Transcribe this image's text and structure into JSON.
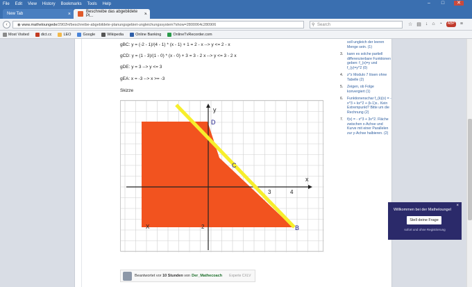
{
  "menu": [
    "File",
    "Edit",
    "View",
    "History",
    "Bookmarks",
    "Tools",
    "Help"
  ],
  "tabs": [
    {
      "label": "New Tab"
    },
    {
      "label": "Beschreibe das abgebildete Pl..."
    }
  ],
  "nav": {
    "url_host": "www.matheloungede",
    "url_path": "/2902H/beschreibe-abgebildete-planungsgebiet-ungleichungssystem?show=2800064c280906",
    "search_placeholder": "Search"
  },
  "bookmarks": [
    {
      "label": "Most Visited",
      "color": "#8a8a8a"
    },
    {
      "label": "dict.cc",
      "color": "#c23b22"
    },
    {
      "label": "LEO",
      "color": "#f2b84b"
    },
    {
      "label": "Google",
      "color": "#4a84d8"
    },
    {
      "label": "Wikipedia",
      "color": "#555555"
    },
    {
      "label": "Online Banking",
      "color": "#2f5fa8"
    },
    {
      "label": "OnlineTvRecorder.com",
      "color": "#2a9a4a"
    }
  ],
  "content": {
    "lines": [
      "gBC: y = (-2 - 1)/(4 - 1) * (x - 1) + 1 = 2 - x --> y <= 2 - x",
      "gCD: y = (1 - 3)/(1 - 0) * (x - 0) + 3 = 3 - 2 x --> y <= 3 - 2 x",
      "gDE: y = 3 --> y <= 3",
      "gEA: x = -3 --> x >= -3"
    ],
    "skizze": "Skizze"
  },
  "graph": {
    "labels": {
      "D": "D",
      "C": "C",
      "B": "B",
      "y": "y",
      "x": "x",
      "tick3": "3",
      "tick4": "4",
      "Xpart": "X",
      "twopart": "2"
    },
    "colors": {
      "region": "#f2531f",
      "line": "#f7ee2c",
      "axis": "#222222",
      "grid": "#cfcfcf",
      "label": "#1c1c8a"
    }
  },
  "answer": {
    "prefix": "Beantwortet vor",
    "time": "10 Stunden",
    "by": "von",
    "user": "Der_Mathecoach",
    "tag": "Experte CXLV"
  },
  "sidebar": {
    "items": [
      {
        "num": "",
        "text": "soll ungleich der leeren Menge sein. (1)"
      },
      {
        "num": "3.",
        "text": "kann es solche partiell differenzierbare Funktionen geben: f_(x)=y und f_(y)=y^2 (0)"
      },
      {
        "num": "4.",
        "text": "z^z Modulo 7 lösen ohne Tabelle (2)"
      },
      {
        "num": "5.",
        "text": "Zeigen, ob Folge konvergiert (1)"
      },
      {
        "num": "6.",
        "text": "Funktionenschar f_(k)(x) = -x^3 + kx^2 + (k-1)x.. Kein Extrempunkt? Bitte um die Rechnung (2)"
      },
      {
        "num": "7.",
        "text": "f(x) = - x^3 + 3x^2. Fläche zwischen x-Achse und Kurve mit einer Parallelen zur y-Achse halbieren. (2)"
      }
    ]
  },
  "popup": {
    "title": "Willkommen bei der Matheloungel",
    "button": "Stell deine Frage",
    "sub": "sofort und ohne Registrierung"
  }
}
